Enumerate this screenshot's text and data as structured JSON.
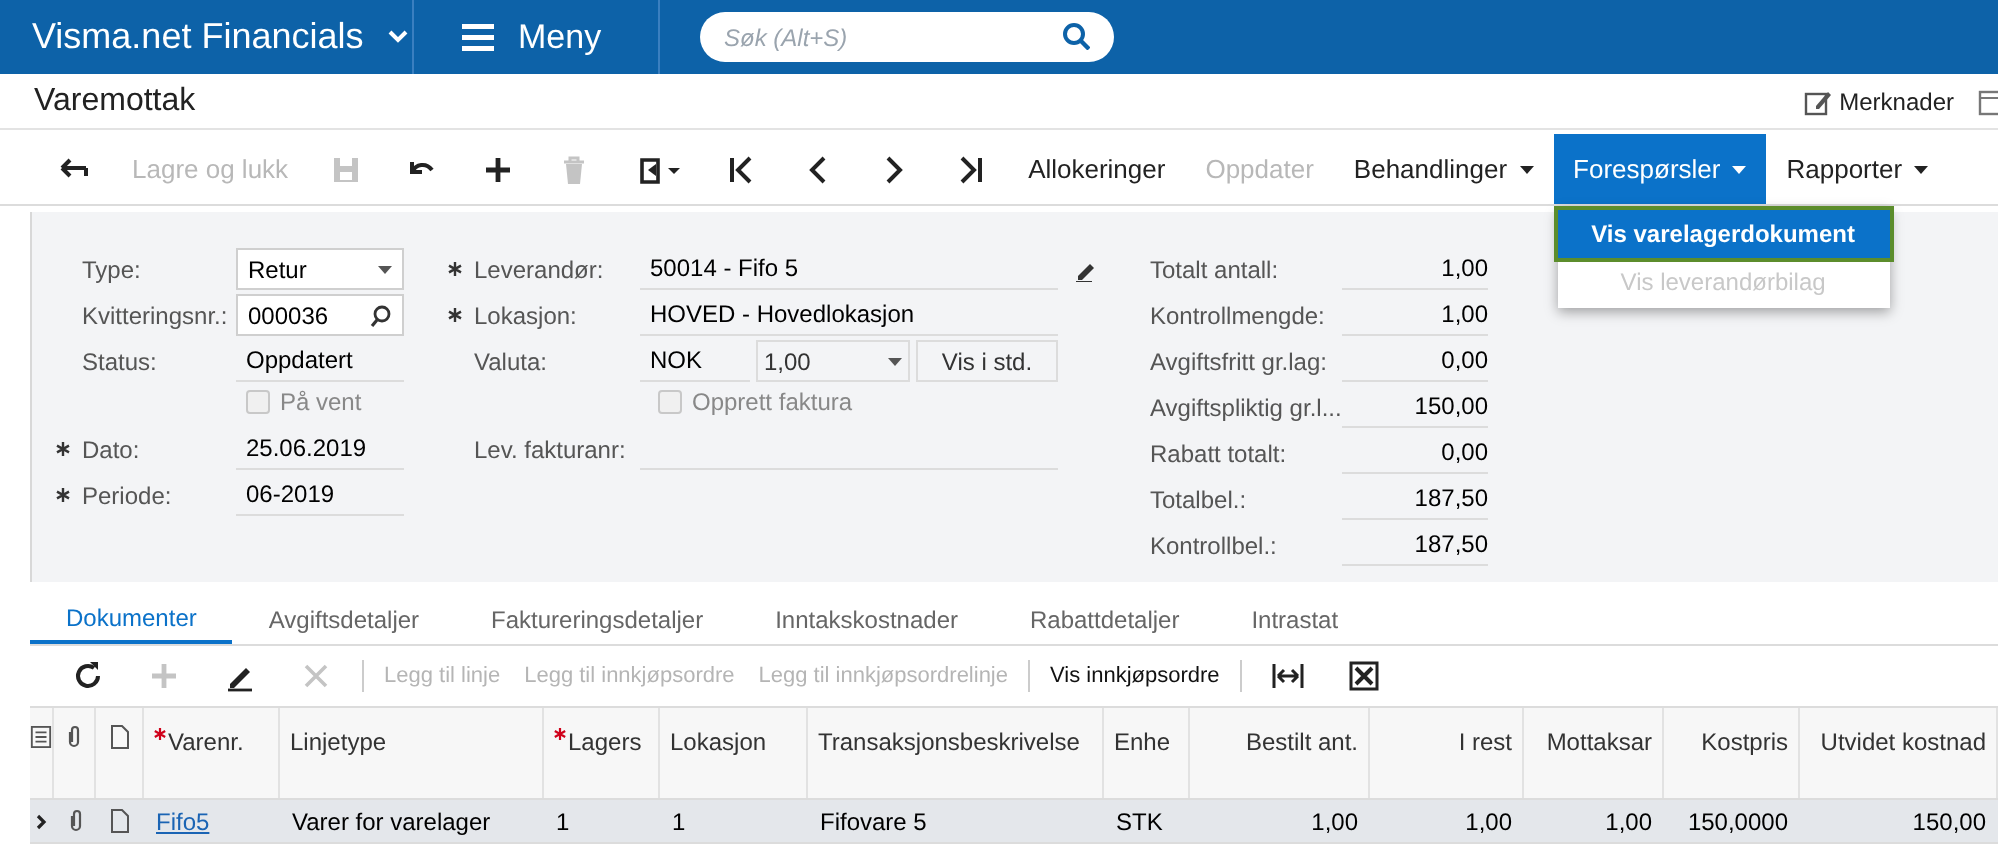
{
  "app_bar": {
    "product": "Visma.net Financials",
    "menu": "Meny",
    "search": {
      "placeholder": "Søk (Alt+S)"
    }
  },
  "page": {
    "title": "Varemottak",
    "notes": "Merknader"
  },
  "toolbar": [
    {
      "kind": "back",
      "disabled": false
    },
    {
      "kind": "text",
      "label": "Lagre og lukk",
      "disabled": true
    },
    {
      "kind": "save",
      "disabled": true
    },
    {
      "kind": "undo",
      "disabled": false
    },
    {
      "kind": "add",
      "disabled": false
    },
    {
      "kind": "delete",
      "disabled": true
    },
    {
      "kind": "paste",
      "disabled": false
    },
    {
      "kind": "first",
      "disabled": false
    },
    {
      "kind": "prev",
      "disabled": false
    },
    {
      "kind": "next",
      "disabled": false
    },
    {
      "kind": "last",
      "disabled": false
    },
    {
      "kind": "text",
      "label": "Allokeringer",
      "disabled": false
    },
    {
      "kind": "text",
      "label": "Oppdater",
      "disabled": true
    },
    {
      "kind": "menu",
      "label": "Behandlinger",
      "disabled": false,
      "expanded": false
    },
    {
      "kind": "menu",
      "label": "Forespørsler",
      "disabled": false,
      "expanded": true
    },
    {
      "kind": "menu",
      "label": "Rapporter",
      "disabled": false,
      "expanded": false
    }
  ],
  "dropdown": [
    {
      "label": "Vis varelagerdokument",
      "selected": true,
      "disabled": false
    },
    {
      "label": "Vis leverandørbilag",
      "selected": false,
      "disabled": true
    }
  ],
  "form": {
    "left": [
      {
        "kind": "select",
        "label": "Type:",
        "value": "Retur",
        "required": false
      },
      {
        "kind": "lookup",
        "label": "Kvitteringsnr.:",
        "value": "000036",
        "required": false
      },
      {
        "kind": "text",
        "label": "Status:",
        "value": "Oppdatert",
        "required": false
      },
      {
        "kind": "checkbox",
        "label": "På vent",
        "checked": false
      },
      {
        "kind": "text",
        "label": "Dato:",
        "value": "25.06.2019",
        "required": true
      },
      {
        "kind": "text",
        "label": "Periode:",
        "value": "06-2019",
        "required": true
      }
    ],
    "middle": [
      {
        "kind": "text",
        "label": "Leverandør:",
        "value": "50014 - Fifo 5",
        "required": true,
        "editable": true
      },
      {
        "kind": "text",
        "label": "Lokasjon:",
        "value": "HOVED - Hovedlokasjon",
        "required": true,
        "editable": false
      },
      {
        "kind": "currency",
        "label": "Valuta:",
        "value": "NOK",
        "rate": "1,00",
        "button": "Vis i std.",
        "required": false
      },
      {
        "kind": "checkbox",
        "label": "Opprett faktura",
        "checked": false
      },
      {
        "kind": "text",
        "label": "Lev. fakturanr:",
        "required": false,
        "editable": false
      }
    ],
    "totals": [
      {
        "label": "Totalt antall:",
        "value": "1,00"
      },
      {
        "label": "Kontrollmengde:",
        "value": "1,00"
      },
      {
        "label": "Avgiftsfritt gr.lag:",
        "value": "0,00"
      },
      {
        "label": "Avgiftspliktig gr.l...",
        "value": "150,00"
      },
      {
        "label": "Rabatt totalt:",
        "value": "0,00"
      },
      {
        "label": "Totalbel.:",
        "value": "187,50"
      },
      {
        "label": "Kontrollbel.:",
        "value": "187,50"
      }
    ]
  },
  "tabs": [
    {
      "label": "Dokumenter",
      "selected": true
    },
    {
      "label": "Avgiftsdetaljer",
      "selected": false
    },
    {
      "label": "Faktureringsdetaljer",
      "selected": false
    },
    {
      "label": "Inntakskostnader",
      "selected": false
    },
    {
      "label": "Rabattdetaljer",
      "selected": false
    },
    {
      "label": "Intrastat",
      "selected": false
    }
  ],
  "grid_toolbar": [
    {
      "kind": "refresh",
      "disabled": false
    },
    {
      "kind": "add",
      "disabled": true
    },
    {
      "kind": "edit",
      "disabled": false
    },
    {
      "kind": "remove",
      "disabled": true
    },
    {
      "kind": "separator"
    },
    {
      "kind": "text",
      "label": "Legg til linje",
      "disabled": true
    },
    {
      "kind": "text",
      "label": "Legg til innkjøpsordre",
      "disabled": true
    },
    {
      "kind": "text",
      "label": "Legg til innkjøpsordrelinje",
      "disabled": true
    },
    {
      "kind": "separator"
    },
    {
      "kind": "text",
      "label": "Vis innkjøpsordre",
      "disabled": false
    },
    {
      "kind": "separator"
    },
    {
      "kind": "fit",
      "disabled": false
    },
    {
      "kind": "excel",
      "disabled": false
    }
  ],
  "table": {
    "columns": [
      {
        "label": "Varenr.",
        "required": true,
        "kind": "link"
      },
      {
        "label": "Linjetype",
        "required": false,
        "kind": "text"
      },
      {
        "label": "Lagers",
        "required": true,
        "kind": "text"
      },
      {
        "label": "Lokasjon",
        "required": false,
        "kind": "text"
      },
      {
        "label": "Transaksjonsbeskrivelse",
        "required": false,
        "kind": "text"
      },
      {
        "label": "Enhe",
        "required": false,
        "kind": "text"
      },
      {
        "label": "Bestilt ant.",
        "required": false,
        "kind": "number"
      },
      {
        "label": "I rest",
        "required": false,
        "kind": "number"
      },
      {
        "label": "Mottaksar",
        "required": false,
        "kind": "number"
      },
      {
        "label": "Kostpris",
        "required": false,
        "kind": "number"
      },
      {
        "label": "Utvidet kostnad",
        "required": false,
        "kind": "number"
      }
    ],
    "rows": [
      {
        "selected": true,
        "cells": [
          "Fifo5",
          "Varer for varelager",
          "1",
          "1",
          "Fifovare 5",
          "STK",
          "1,00",
          "1,00",
          "1,00",
          "150,0000",
          "150,00"
        ]
      }
    ]
  }
}
